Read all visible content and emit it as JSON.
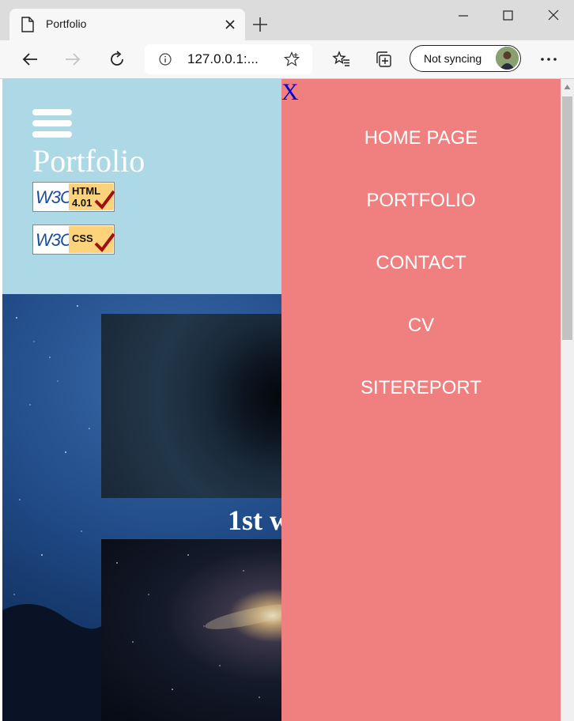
{
  "browser": {
    "tab_title": "Portfolio",
    "url": "127.0.0.1:...",
    "sync_label": "Not syncing"
  },
  "site": {
    "title": "Portfolio",
    "badges": [
      "W3C HTML 4.01",
      "W3C CSS"
    ],
    "work_heading": "1st w"
  },
  "nav": {
    "close_label": "X",
    "items": [
      "HOME PAGE",
      "PORTFOLIO",
      "CONTACT",
      "CV",
      "SITEREPORT"
    ]
  }
}
